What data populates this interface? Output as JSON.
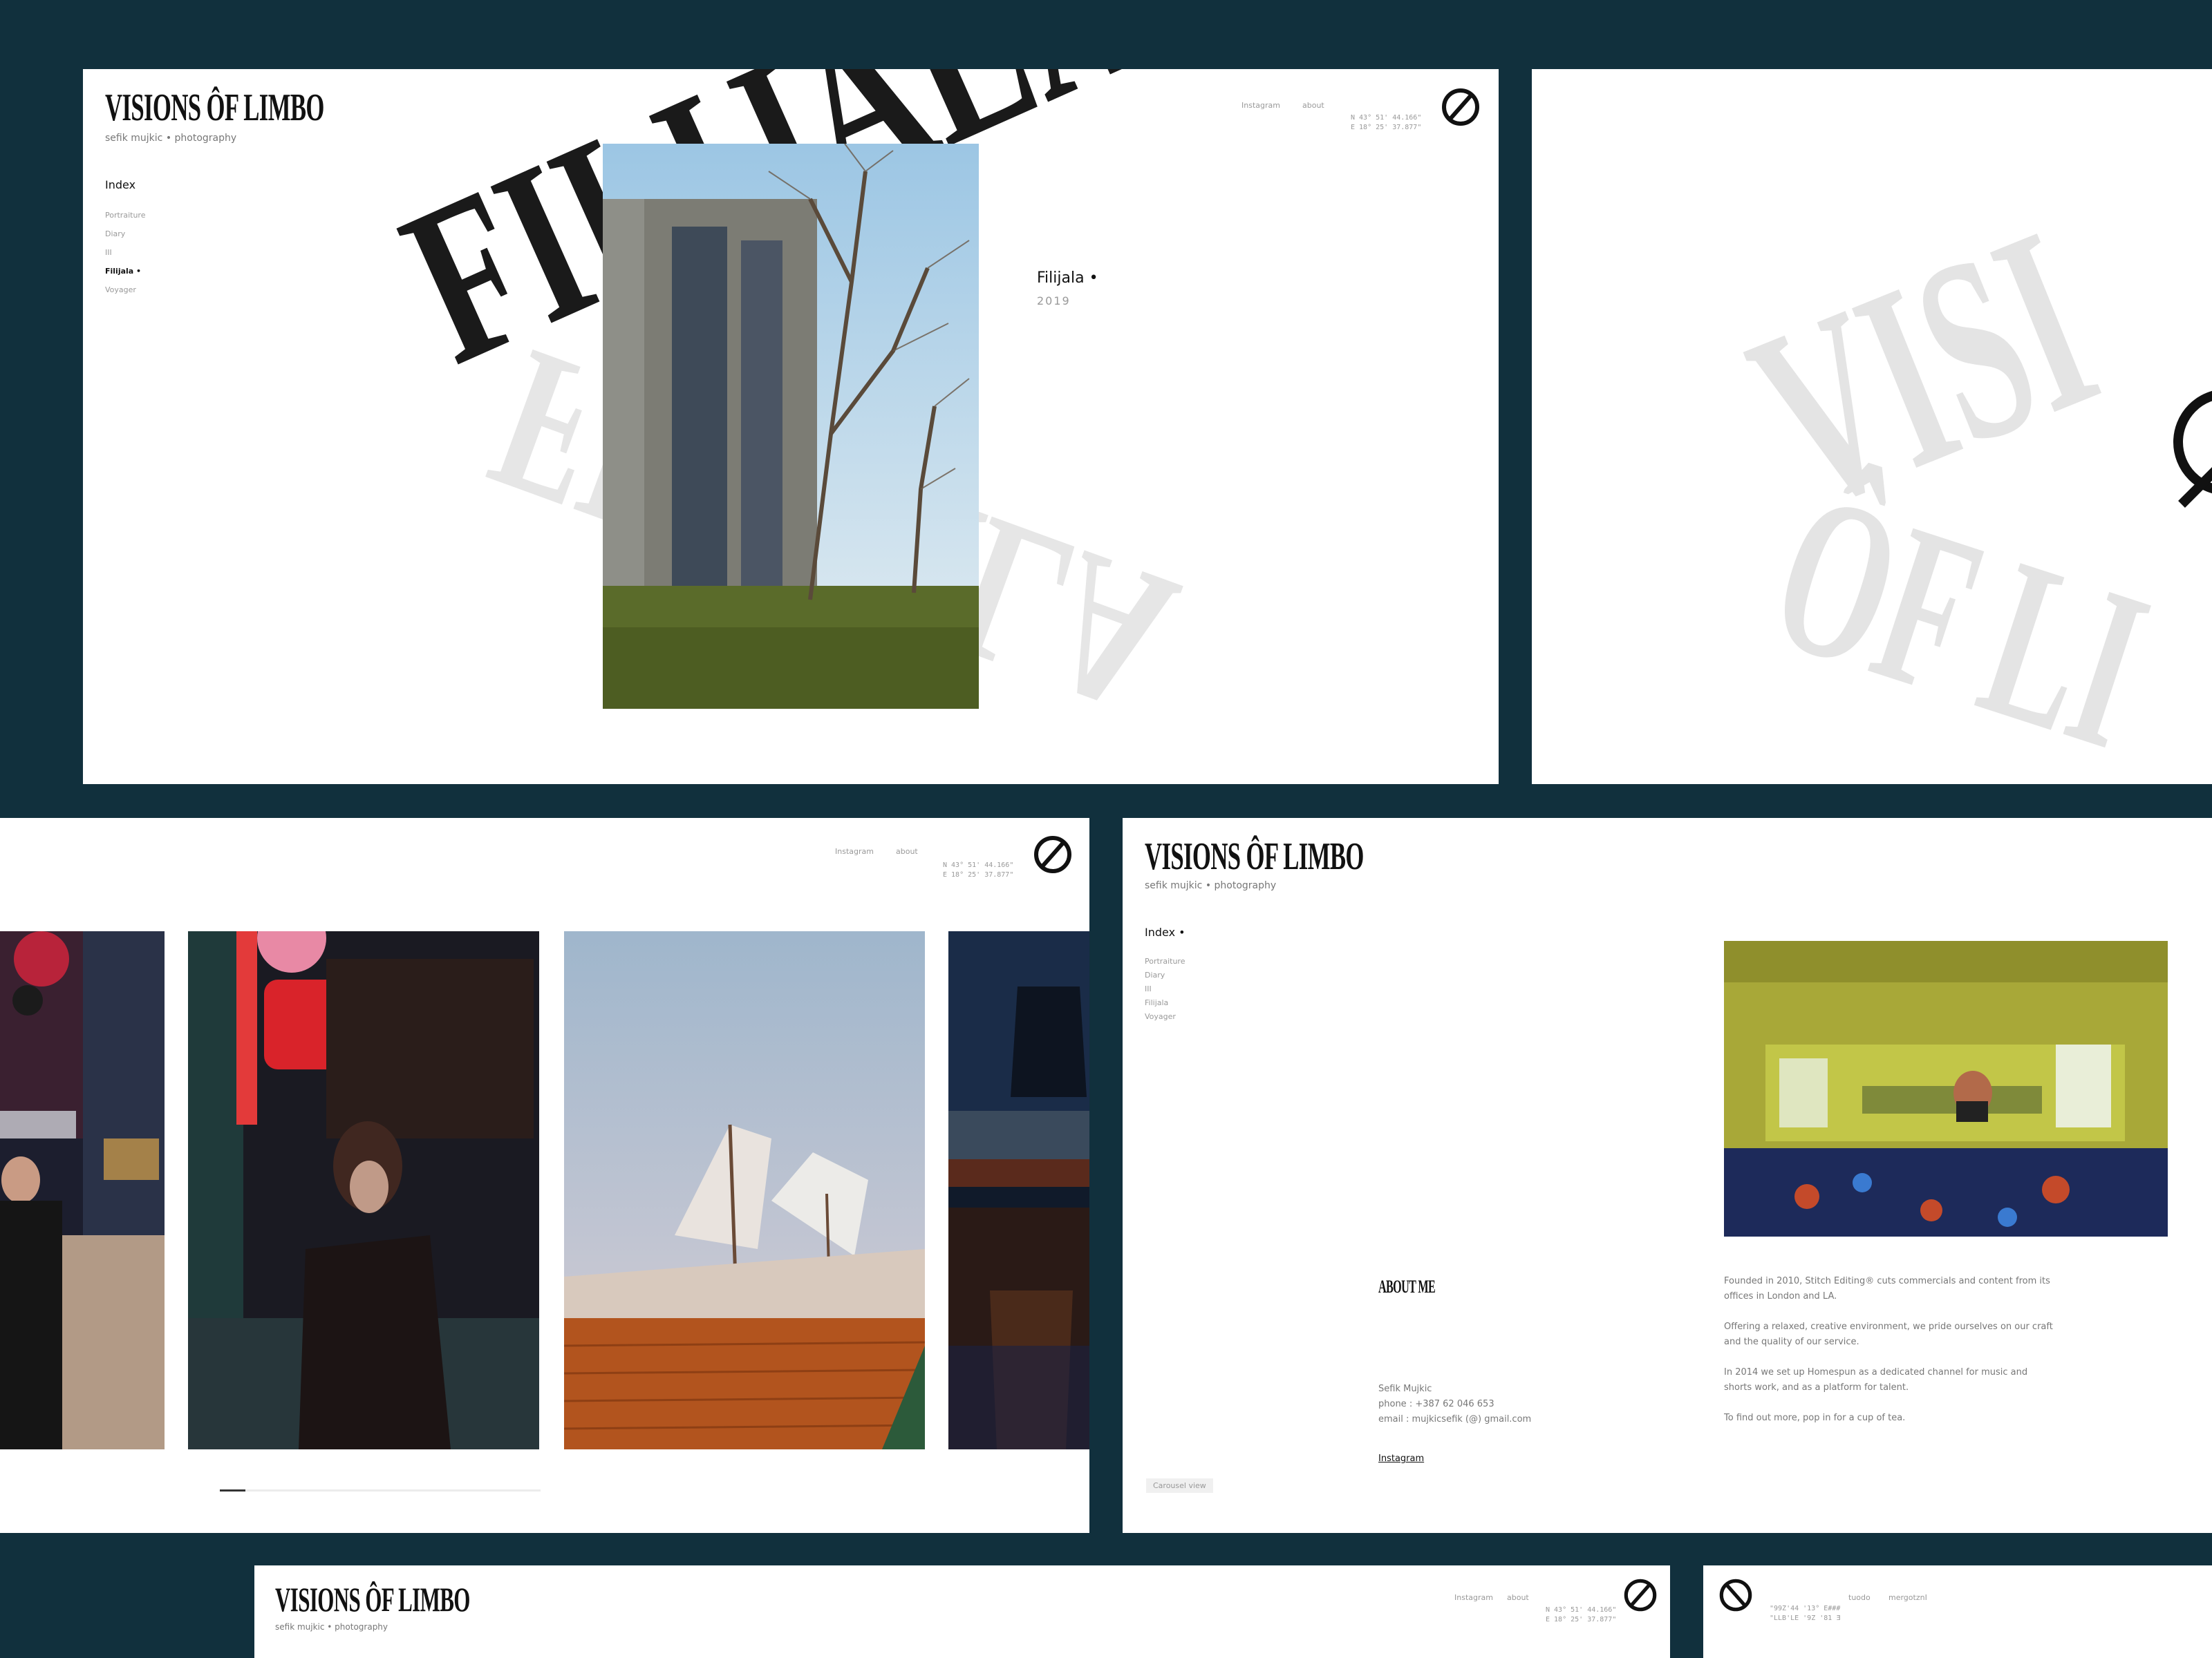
{
  "site": {
    "logo": "VISIONS ÔF LIMBO",
    "tagline": "sefik mujkic • photography"
  },
  "nav": {
    "instagram": "Instagram",
    "about": "about",
    "coords_line1": "N 43° 51' 44.166\"",
    "coords_line2": "E 18° 25' 37.877\""
  },
  "index": {
    "title": "Index",
    "title_dot": "Index •",
    "items": [
      "Portraiture",
      "Diary",
      "III",
      "Filijala •",
      "Voyager"
    ],
    "items_plain": [
      "Portraiture",
      "Diary",
      "III",
      "Filijala",
      "Voyager"
    ]
  },
  "project": {
    "bg_word": "FILIJALA",
    "title": "Filijala •",
    "year": "2019"
  },
  "panel2": {
    "bg_word_1": "VISI",
    "bg_word_2": "ÔF LI"
  },
  "about": {
    "heading": "ABOUT ME",
    "contact_name": "Sefik Mujkic",
    "contact_phone": "phone : +387 62 046 653",
    "contact_email": "email : mujkicsefik (@) gmail.com",
    "instagram_link": "Instagram",
    "para1": "Founded in 2010, Stitch Editing® cuts commercials and content from its offices in London and LA.",
    "para2": "Offering a relaxed, creative environment, we pride ourselves on our craft and the quality of our service.",
    "para3": "In 2014 we set up Homespun as a dedicated channel for music and shorts work, and as a platform for talent.",
    "para4": "To find out more, pop in for a cup of tea.",
    "carousel_button": "Carousel view"
  },
  "panel6": {
    "coords_line1": "\"99Z'44 '13° E###",
    "coords_line2": "\"LLB'LE '9Z '81 Ǝ",
    "link1": "tuodo",
    "link2": "mergotznI"
  },
  "gallery": {
    "scroll_progress": 0.08
  }
}
